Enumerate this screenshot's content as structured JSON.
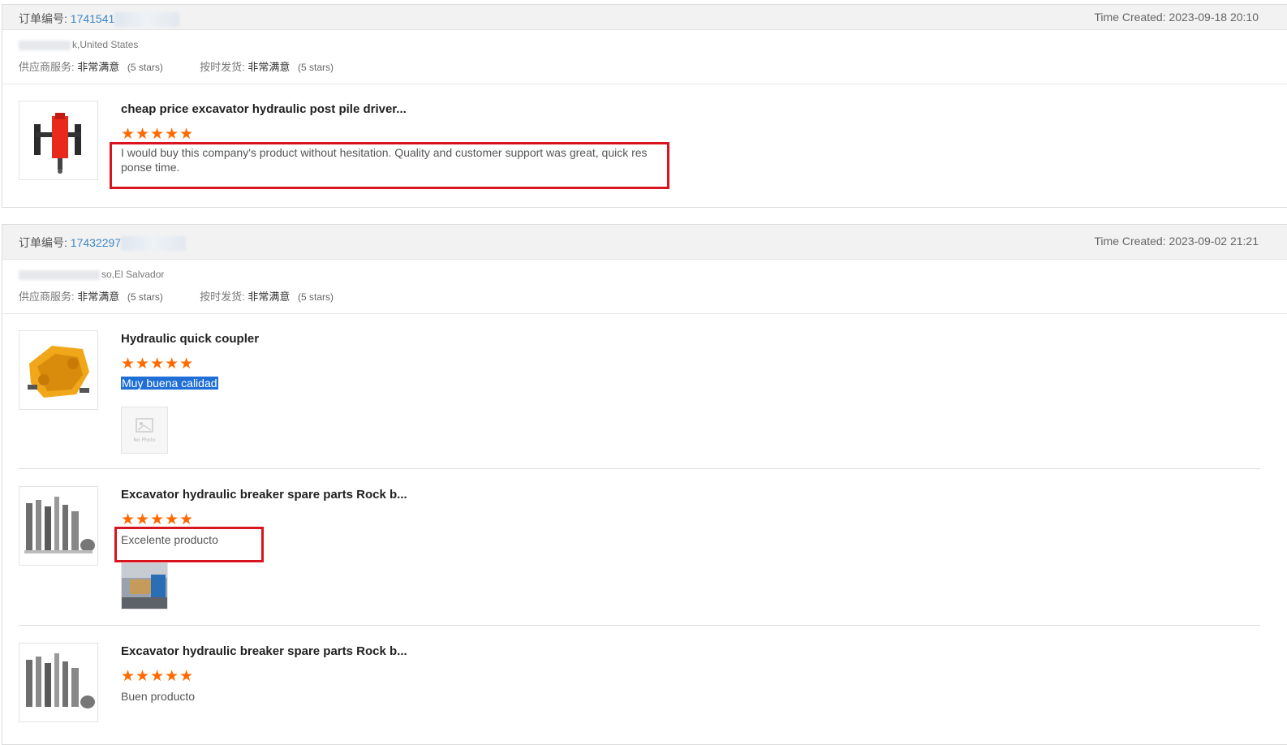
{
  "orders": [
    {
      "label": "订单编号:",
      "number": "1741541",
      "time": "Time Created: 2023-09-18 20:10",
      "buyer_location": "k,United States",
      "supplier_service_label": "供应商服务:",
      "supplier_service_value": "非常满意",
      "supplier_service_stars": "(5 stars)",
      "on_time_label": "按时发货:",
      "on_time_value": "非常满意",
      "on_time_stars": "(5 stars)",
      "items": [
        {
          "title": "cheap price excavator hydraulic post pile driver...",
          "stars": "★★★★★",
          "comment_line1": "I would buy this company's product without hesitation.   Quality and customer support was great, quick res",
          "comment_line2": "ponse time."
        }
      ]
    },
    {
      "label": "订单编号:",
      "number": "17432297",
      "time": "Time Created: 2023-09-02 21:21",
      "buyer_location": "so,El Salvador",
      "supplier_service_label": "供应商服务:",
      "supplier_service_value": "非常满意",
      "supplier_service_stars": "(5 stars)",
      "on_time_label": "按时发货:",
      "on_time_value": "非常满意",
      "on_time_stars": "(5 stars)",
      "items": [
        {
          "title": "Hydraulic quick coupler",
          "stars": "★★★★★",
          "comment": "Muy buena calidad",
          "photo_placeholder": "No Photo"
        },
        {
          "title": "Excavator hydraulic breaker spare parts Rock b...",
          "stars": "★★★★★",
          "comment": "Excelente producto"
        },
        {
          "title": "Excavator hydraulic breaker spare parts Rock b...",
          "stars": "★★★★★",
          "comment": "Buen producto"
        }
      ]
    }
  ],
  "colors": {
    "star": "#ff6a00",
    "order_link": "#3a86c8",
    "annotation_box": "#d9141f",
    "selection": "#1f6fd6"
  }
}
